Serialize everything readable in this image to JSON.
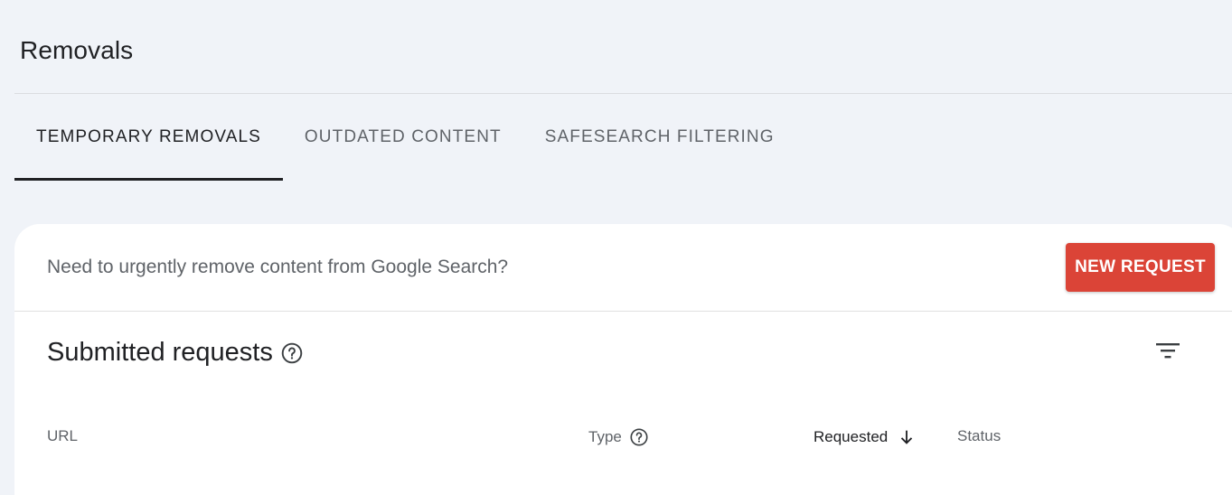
{
  "page": {
    "title": "Removals"
  },
  "tabs": [
    {
      "label": "TEMPORARY REMOVALS",
      "active": true
    },
    {
      "label": "OUTDATED CONTENT",
      "active": false
    },
    {
      "label": "SAFESEARCH FILTERING",
      "active": false
    }
  ],
  "banner": {
    "text": "Need to urgently remove content from Google Search?",
    "button_label": "NEW REQUEST",
    "button_color": "#db4437"
  },
  "requests": {
    "title": "Submitted requests",
    "columns": {
      "url": "URL",
      "type": "Type",
      "requested": "Requested",
      "status": "Status"
    },
    "sort": {
      "column": "requested",
      "direction": "descending"
    }
  },
  "icons": {
    "help": "help-circle-icon",
    "filter": "filter-list-icon",
    "sort": "arrow-down-icon"
  }
}
